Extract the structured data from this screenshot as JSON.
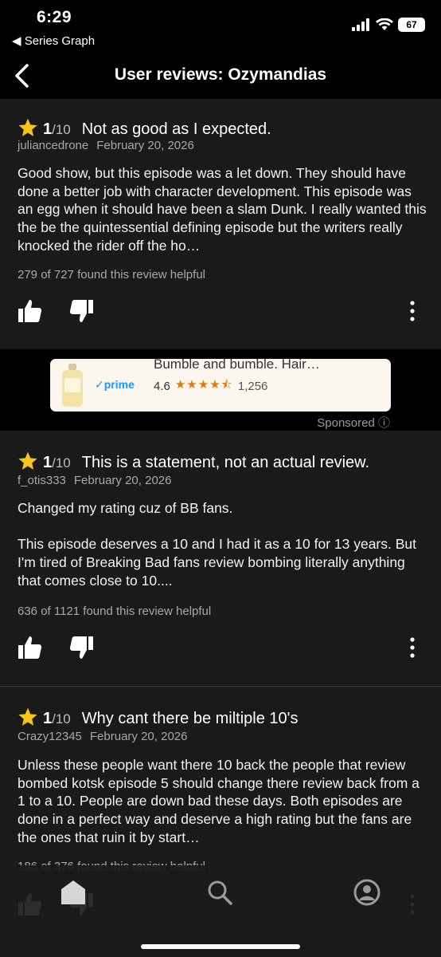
{
  "status": {
    "time": "6:29",
    "back_app": "◀ Series Graph",
    "battery": "67"
  },
  "nav": {
    "title": "User reviews: Ozymandias"
  },
  "reviews": [
    {
      "rating": "1",
      "rating_max": "/10",
      "title": "Not as good as I expected.",
      "user": "juliancedrone",
      "date": "February 20, 2026",
      "body": "Good show, but this episode was a let down. They should have done a better job with character development. This episode was an egg when it should have been a slam Dunk. I really wanted this the be the quintessential defining episode but the writers really knocked the rider off the ho…",
      "helpful": "279 of 727 found this review helpful"
    },
    {
      "rating": "1",
      "rating_max": "/10",
      "title": "This is a statement, not an actual review.",
      "user": "f_otis333",
      "date": "February 20, 2026",
      "body": "Changed my rating cuz of BB fans.\n\nThis episode deserves a 10 and I had it as a 10 for 13 years. But I'm tired of Breaking Bad fans review bombing literally anything that comes close to 10....",
      "helpful": "636 of 1121 found this review helpful"
    },
    {
      "rating": "1",
      "rating_max": "/10",
      "title": "Why cant there be miltiple 10's",
      "user": "Crazy12345",
      "date": "February 20, 2026",
      "body": "Unless these people want there 10 back the people that review bombed kotsk episode 5 should change there review back from a 1 to a 10. People are down bad these days. Both episodes are done in a perfect way and deserve a high rating but the fans are the ones that ruin it by start…",
      "helpful": "186 of 376 found this review helpful"
    }
  ],
  "ad": {
    "title": "Bumble and bumble. Hair…",
    "prime": "✓prime",
    "rating": "4.6",
    "stars": "★★★★⯪",
    "count": "1,256",
    "sponsored": "Sponsored ⓘ"
  },
  "tabs": [
    "home-icon",
    "search-icon",
    "profile-icon"
  ],
  "colors": {
    "background": "#1a1a1a",
    "star": "#f5c518",
    "prime": "#1a98ff",
    "ad_stars": "#e47911"
  }
}
